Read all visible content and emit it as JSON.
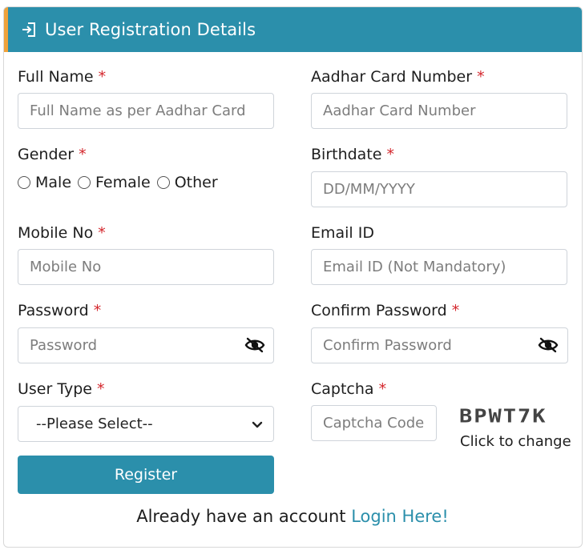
{
  "header": {
    "title": "User Registration Details",
    "icon": "login-icon"
  },
  "fields": {
    "full_name": {
      "label": "Full Name",
      "placeholder": "Full Name as per Aadhar Card",
      "required": "*"
    },
    "aadhar": {
      "label": "Aadhar Card Number",
      "placeholder": "Aadhar Card Number",
      "required": "*"
    },
    "gender": {
      "label": "Gender",
      "required": "*",
      "options": [
        "Male",
        "Female",
        "Other"
      ]
    },
    "birthdate": {
      "label": "Birthdate",
      "placeholder": "DD/MM/YYYY",
      "required": "*"
    },
    "mobile": {
      "label": "Mobile No",
      "placeholder": "Mobile No",
      "required": "*"
    },
    "email": {
      "label": "Email ID",
      "placeholder": "Email ID (Not Mandatory)"
    },
    "password": {
      "label": "Password",
      "placeholder": "Password",
      "required": "*"
    },
    "confirm_password": {
      "label": "Confirm Password",
      "placeholder": "Confirm Password",
      "required": "*"
    },
    "user_type": {
      "label": "User Type",
      "required": "*",
      "selected": "--Please Select--"
    },
    "captcha": {
      "label": "Captcha",
      "placeholder": "Captcha Code",
      "required": "*",
      "code": "BPWT7K",
      "change_text": "Click to change"
    }
  },
  "register_label": "Register",
  "footer": {
    "text": "Already have an account",
    "link": "Login Here!"
  },
  "colors": {
    "primary": "#2b8fab",
    "accent": "#f0a23a",
    "required": "#d4262c"
  }
}
